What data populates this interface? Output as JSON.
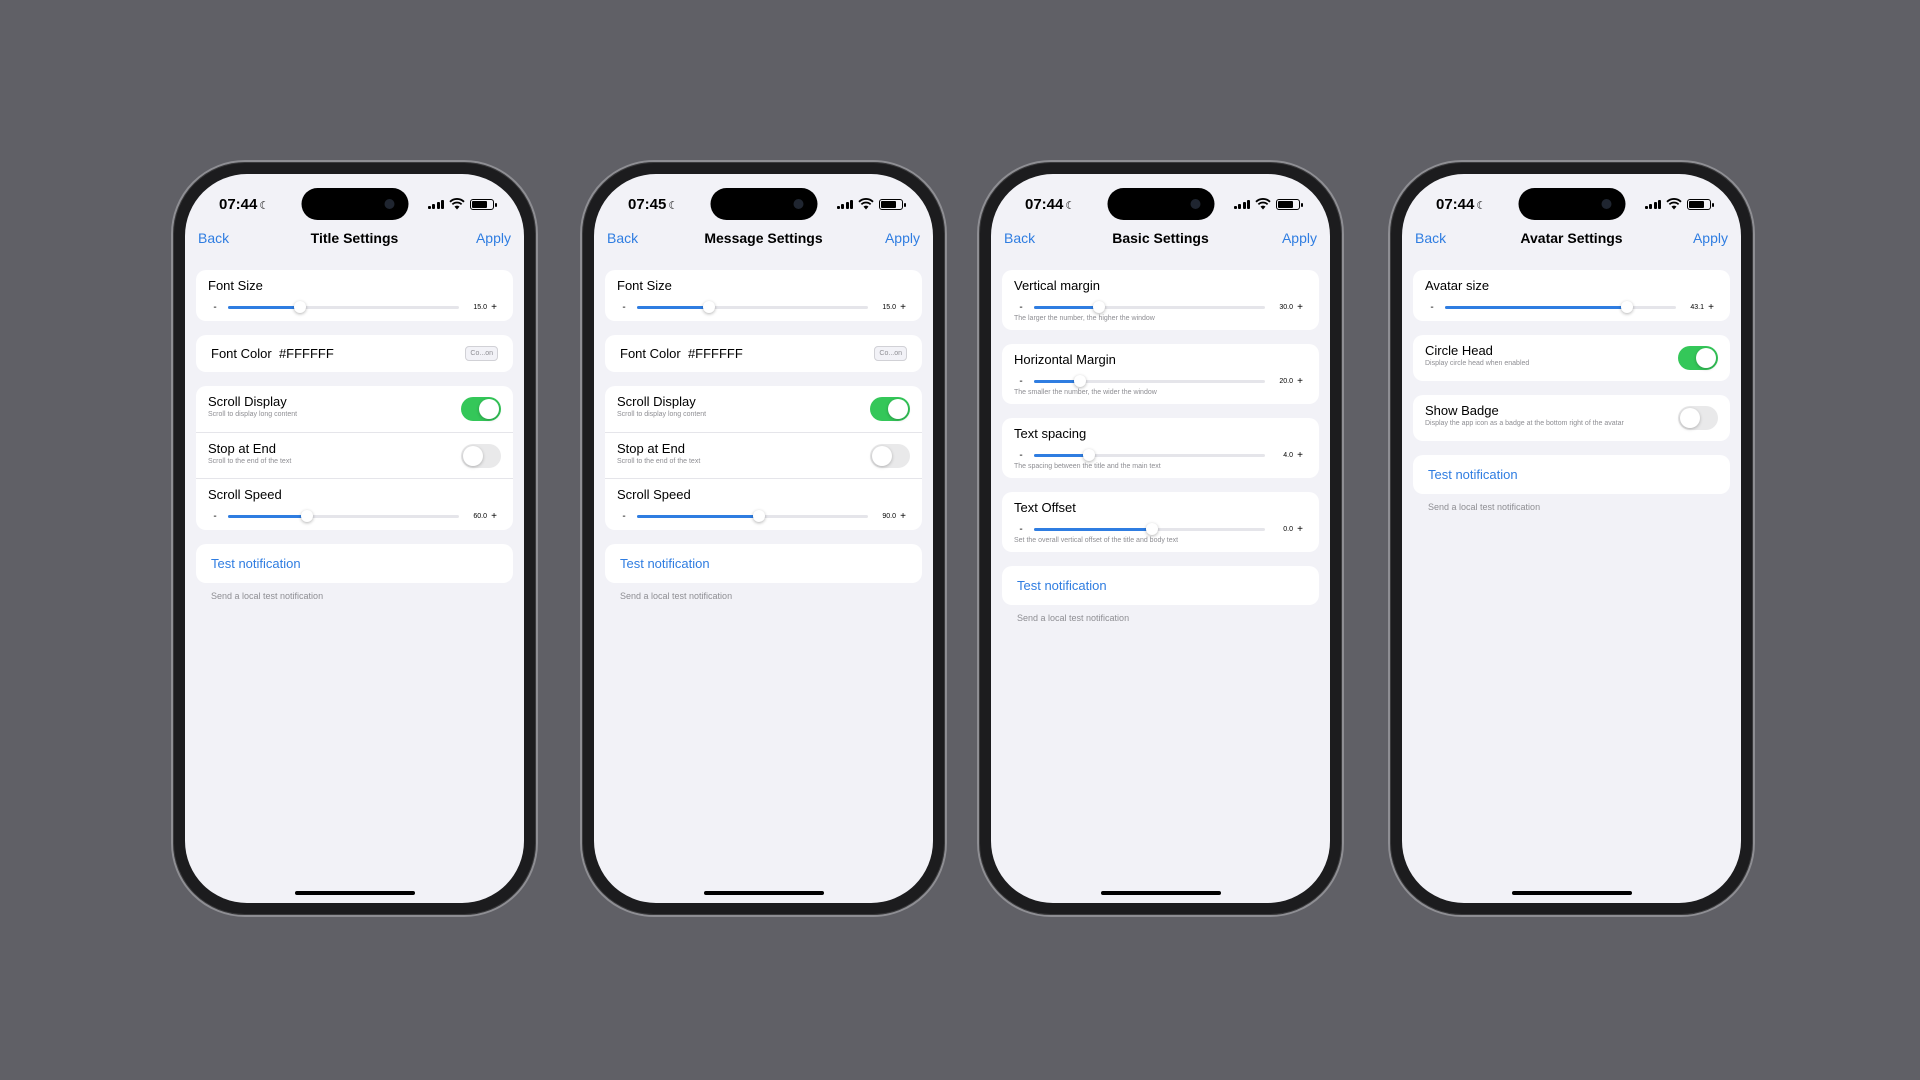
{
  "colors": {
    "accent": "#2f7de1",
    "toggle_on": "#34c759",
    "background": "#606066"
  },
  "phones": [
    {
      "time": "07:44",
      "nav": {
        "back": "Back",
        "title": "Title Settings",
        "apply": "Apply"
      },
      "font_size": {
        "label": "Font Size",
        "minus": "-",
        "plus": "+",
        "value": "15.0",
        "fraction": 0.31
      },
      "font_color": {
        "label": "Font Color",
        "hex": "#FFFFFF",
        "chip": "Co...on"
      },
      "scroll_display": {
        "label": "Scroll Display",
        "sub": "Scroll to display long content",
        "on": true
      },
      "stop_at_end": {
        "label": "Stop at End",
        "sub": "Scroll to the end of the text",
        "on": false
      },
      "scroll_speed": {
        "label": "Scroll Speed",
        "minus": "-",
        "plus": "+",
        "value": "60.0",
        "fraction": 0.34
      },
      "test": {
        "label": "Test notification",
        "sub": "Send a local test notification"
      }
    },
    {
      "time": "07:45",
      "nav": {
        "back": "Back",
        "title": "Message Settings",
        "apply": "Apply"
      },
      "font_size": {
        "label": "Font Size",
        "minus": "-",
        "plus": "+",
        "value": "15.0",
        "fraction": 0.31
      },
      "font_color": {
        "label": "Font Color",
        "hex": "#FFFFFF",
        "chip": "Co...on"
      },
      "scroll_display": {
        "label": "Scroll Display",
        "sub": "Scroll to display long content",
        "on": true
      },
      "stop_at_end": {
        "label": "Stop at End",
        "sub": "Scroll to the end of the text",
        "on": false
      },
      "scroll_speed": {
        "label": "Scroll Speed",
        "minus": "-",
        "plus": "+",
        "value": "90.0",
        "fraction": 0.53
      },
      "test": {
        "label": "Test notification",
        "sub": "Send a local test notification"
      }
    },
    {
      "time": "07:44",
      "nav": {
        "back": "Back",
        "title": "Basic Settings",
        "apply": "Apply"
      },
      "vertical_margin": {
        "label": "Vertical margin",
        "minus": "-",
        "plus": "+",
        "value": "30.0",
        "fraction": 0.28,
        "sub": "The larger the number, the higher the window"
      },
      "horizontal_margin": {
        "label": "Horizontal Margin",
        "minus": "-",
        "plus": "+",
        "value": "20.0",
        "fraction": 0.2,
        "sub": "The smaller the number, the wider the window"
      },
      "text_spacing": {
        "label": "Text spacing",
        "minus": "-",
        "plus": "+",
        "value": "4.0",
        "fraction": 0.24,
        "sub": "The spacing between the title and the main text"
      },
      "text_offset": {
        "label": "Text Offset",
        "minus": "-",
        "plus": "+",
        "value": "0.0",
        "fraction": 0.51,
        "sub": "Set the overall vertical offset of the title and body text"
      },
      "test": {
        "label": "Test notification",
        "sub": "Send a local test notification"
      }
    },
    {
      "time": "07:44",
      "nav": {
        "back": "Back",
        "title": "Avatar Settings",
        "apply": "Apply"
      },
      "avatar_size": {
        "label": "Avatar size",
        "minus": "-",
        "plus": "+",
        "value": "43.1",
        "fraction": 0.79
      },
      "circle_head": {
        "label": "Circle Head",
        "sub": "Display circle head when enabled",
        "on": true
      },
      "show_badge": {
        "label": "Show Badge",
        "sub": "Display the app icon as a badge at the bottom right of the avatar",
        "on": false
      },
      "test": {
        "label": "Test notification",
        "sub": "Send a local test notification"
      }
    }
  ]
}
